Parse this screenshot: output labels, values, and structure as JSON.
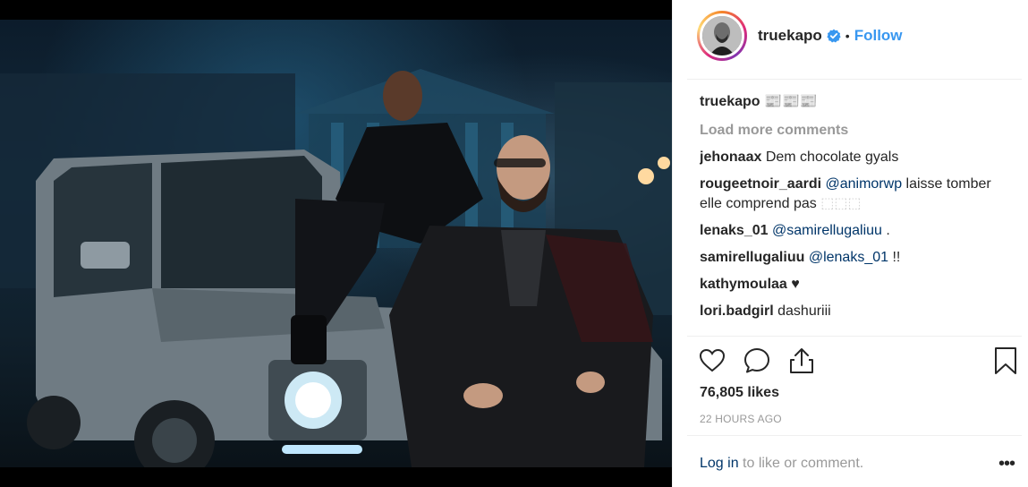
{
  "post": {
    "author": "truekapo",
    "separator": "•",
    "follow_label": "Follow",
    "caption_user": "truekapo",
    "caption_text": "📰📰📰",
    "load_more_label": "Load more comments",
    "comments": [
      {
        "user": "jehonaax",
        "mention": "",
        "text": "Dem chocolate gyals",
        "faint": ""
      },
      {
        "user": "rougeetnoir_aardi",
        "mention": "@animorwp",
        "text": "laisse tomber elle comprend pas",
        "faint": "⬚⬚⬚"
      },
      {
        "user": "lenaks_01",
        "mention": "@samirellugaliuu",
        "text": ".",
        "faint": ""
      },
      {
        "user": "samirellugaliuu",
        "mention": "@lenaks_01",
        "text": "!!",
        "faint": ""
      },
      {
        "user": "kathymoulaa",
        "mention": "",
        "text": "♥",
        "faint": ""
      },
      {
        "user": "lori.badgirl",
        "mention": "",
        "text": "dashuriii",
        "faint": ""
      }
    ],
    "likes": "76,805 likes",
    "time": "22 HOURS AGO",
    "login_link": "Log in",
    "login_text": "to like or comment.",
    "more_label": "•••"
  },
  "icons": {
    "like": "heart-icon",
    "comment": "comment-icon",
    "share": "share-icon",
    "save": "bookmark-icon",
    "verified": "verified-badge-icon"
  },
  "colors": {
    "accent": "#3897f0",
    "mention": "#003569",
    "muted": "#999999",
    "text": "#262626"
  }
}
